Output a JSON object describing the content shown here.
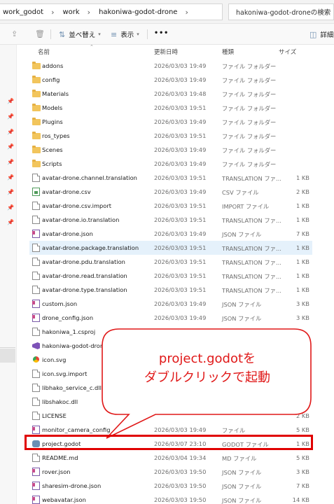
{
  "address_bar": {
    "breadcrumbs": [
      "work_godot",
      "work",
      "hakoniwa-godot-drone"
    ],
    "search_placeholder": "hakoniwa-godot-droneの検索"
  },
  "toolbar": {
    "sort_label": "並べ替え",
    "view_label": "表示",
    "more_label": "•••",
    "details_label": "詳細"
  },
  "columns": {
    "name": "名前",
    "date": "更新日時",
    "type": "種類",
    "size": "サイズ"
  },
  "files": [
    {
      "name": "addons",
      "date": "2026/03/03 19:49",
      "type": "ファイル フォルダー",
      "size": "",
      "icon": "folder-icon"
    },
    {
      "name": "config",
      "date": "2026/03/03 19:49",
      "type": "ファイル フォルダー",
      "size": "",
      "icon": "folder-icon"
    },
    {
      "name": "Materials",
      "date": "2026/03/03 19:48",
      "type": "ファイル フォルダー",
      "size": "",
      "icon": "folder-icon"
    },
    {
      "name": "Models",
      "date": "2026/03/03 19:51",
      "type": "ファイル フォルダー",
      "size": "",
      "icon": "folder-icon"
    },
    {
      "name": "Plugins",
      "date": "2026/03/03 19:49",
      "type": "ファイル フォルダー",
      "size": "",
      "icon": "folder-icon"
    },
    {
      "name": "ros_types",
      "date": "2026/03/03 19:51",
      "type": "ファイル フォルダー",
      "size": "",
      "icon": "folder-icon"
    },
    {
      "name": "Scenes",
      "date": "2026/03/03 19:49",
      "type": "ファイル フォルダー",
      "size": "",
      "icon": "folder-icon"
    },
    {
      "name": "Scripts",
      "date": "2026/03/03 19:49",
      "type": "ファイル フォルダー",
      "size": "",
      "icon": "folder-icon"
    },
    {
      "name": "avatar-drone.channel.translation",
      "date": "2026/03/03 19:51",
      "type": "TRANSLATION ファ...",
      "size": "1 KB",
      "icon": "file-icon"
    },
    {
      "name": "avatar-drone.csv",
      "date": "2026/03/03 19:49",
      "type": "CSV ファイル",
      "size": "2 KB",
      "icon": "csv-icon"
    },
    {
      "name": "avatar-drone.csv.import",
      "date": "2026/03/03 19:51",
      "type": "IMPORT ファイル",
      "size": "1 KB",
      "icon": "file-icon"
    },
    {
      "name": "avatar-drone.io.translation",
      "date": "2026/03/03 19:51",
      "type": "TRANSLATION ファ...",
      "size": "1 KB",
      "icon": "file-icon"
    },
    {
      "name": "avatar-drone.json",
      "date": "2026/03/03 19:49",
      "type": "JSON ファイル",
      "size": "7 KB",
      "icon": "json-icon"
    },
    {
      "name": "avatar-drone.package.translation",
      "date": "2026/03/03 19:51",
      "type": "TRANSLATION ファ...",
      "size": "1 KB",
      "icon": "file-icon"
    },
    {
      "name": "avatar-drone.pdu.translation",
      "date": "2026/03/03 19:51",
      "type": "TRANSLATION ファ...",
      "size": "1 KB",
      "icon": "file-icon"
    },
    {
      "name": "avatar-drone.read.translation",
      "date": "2026/03/03 19:51",
      "type": "TRANSLATION ファ...",
      "size": "1 KB",
      "icon": "file-icon"
    },
    {
      "name": "avatar-drone.type.translation",
      "date": "2026/03/03 19:51",
      "type": "TRANSLATION ファ...",
      "size": "1 KB",
      "icon": "file-icon"
    },
    {
      "name": "custom.json",
      "date": "2026/03/03 19:49",
      "type": "JSON ファイル",
      "size": "3 KB",
      "icon": "json-icon"
    },
    {
      "name": "drone_config.json",
      "date": "2026/03/03 19:49",
      "type": "JSON ファイル",
      "size": "3 KB",
      "icon": "json-icon"
    },
    {
      "name": "hakoniwa_1.csproj",
      "date": "",
      "type": "",
      "size": "",
      "icon": "file-icon"
    },
    {
      "name": "hakoniwa-godot-drone",
      "date": "",
      "type": "",
      "size": "",
      "icon": "vs-icon"
    },
    {
      "name": "icon.svg",
      "date": "",
      "type": "",
      "size": "",
      "icon": "svg-icon"
    },
    {
      "name": "icon.svg.import",
      "date": "",
      "type": "",
      "size": "",
      "icon": "file-icon"
    },
    {
      "name": "libhako_service_c.dll",
      "date": "",
      "type": "",
      "size": "",
      "icon": "file-icon"
    },
    {
      "name": "libshakoc.dll",
      "date": "",
      "type": "",
      "size": "",
      "icon": "file-icon"
    },
    {
      "name": "LICENSE",
      "date": "",
      "type": "",
      "size": "2 KB",
      "icon": "file-icon"
    },
    {
      "name": "monitor_camera_config",
      "date": "2026/03/03 19:49",
      "type": "ファイル",
      "size": "5 KB",
      "icon": "json-icon"
    },
    {
      "name": "project.godot",
      "date": "2026/03/07 23:10",
      "type": "GODOT ファイル",
      "size": "1 KB",
      "icon": "godot-icon"
    },
    {
      "name": "README.md",
      "date": "2026/03/04 19:34",
      "type": "MD ファイル",
      "size": "5 KB",
      "icon": "file-icon"
    },
    {
      "name": "rover.json",
      "date": "2026/03/03 19:50",
      "type": "JSON ファイル",
      "size": "3 KB",
      "icon": "json-icon"
    },
    {
      "name": "sharesim-drone.json",
      "date": "2026/03/03 19:50",
      "type": "JSON ファイル",
      "size": "7 KB",
      "icon": "json-icon"
    },
    {
      "name": "webavatar.json",
      "date": "2026/03/03 19:50",
      "type": "JSON ファイル",
      "size": "14 KB",
      "icon": "json-icon"
    }
  ],
  "callout": {
    "line1": "project.godotを",
    "line2": "ダブルクリックで起動",
    "color": "#e01818"
  },
  "colors": {
    "folder": "#f2c55c",
    "selection": "#e5f1fb",
    "highlight_border": "#e00000"
  }
}
